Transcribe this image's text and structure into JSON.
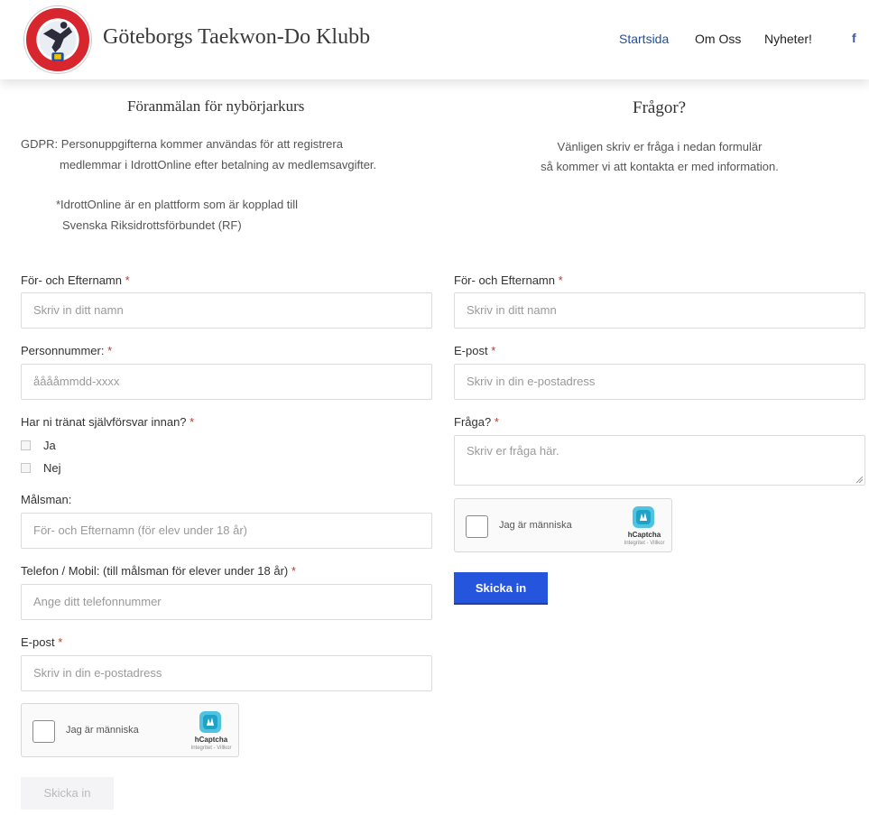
{
  "header": {
    "logo_text": "GÖTEBORGS TAEKWON-DO CLUB",
    "site_title": "Göteborgs Taekwon-Do Klubb",
    "nav": [
      {
        "label": "Startsida",
        "active": true
      },
      {
        "label": "Om Oss",
        "active": false
      },
      {
        "label": "Nyheter!",
        "active": false
      }
    ],
    "facebook_glyph": "f",
    "colors": {
      "active_nav": "#1f4f9c",
      "logo_red": "#d7262e",
      "facebook": "#3b5998"
    }
  },
  "left": {
    "title": "Föranmälan för nybörjarkurs",
    "gdpr_line1": "GDPR: Personuppgifterna kommer användas för att registrera",
    "gdpr_line2": "medlemmar i IdrottOnline efter betalning av medlemsavgifter.",
    "note_line1": "*IdrottOnline är en plattform som är kopplad till",
    "note_line2": "Svenska Riksidrottsförbundet (RF)",
    "fields": {
      "name_label": "För- och Efternamn",
      "name_placeholder": "Skriv in ditt namn",
      "pnr_label": "Personnummer:",
      "pnr_placeholder": "ååååmmdd-xxxx",
      "selfdef_label": "Har ni tränat självförsvar innan?",
      "option_yes": "Ja",
      "option_no": "Nej",
      "guardian_label": "Målsman:",
      "guardian_placeholder": "För- och Efternamn (för elev under 18 år)",
      "phone_label": "Telefon / Mobil: (till målsman för elever under 18 år)",
      "phone_placeholder": "Ange ditt telefonnummer",
      "email_label": "E-post",
      "email_placeholder": "Skriv in din e-postadress"
    },
    "required_mark": "*",
    "captcha": {
      "text": "Jag är människa",
      "brand": "hCaptcha",
      "links": "Integritet - Villkor"
    },
    "submit_label": "Skicka in"
  },
  "right": {
    "title": "Frågor?",
    "info_line1": "Vänligen skriv er fråga i nedan formulär",
    "info_line2": "så kommer vi att kontakta er med information.",
    "fields": {
      "name_label": "För- och Efternamn",
      "name_placeholder": "Skriv in ditt namn",
      "email_label": "E-post",
      "email_placeholder": "Skriv in din e-postadress",
      "question_label": "Fråga?",
      "question_placeholder": "Skriv er fråga här."
    },
    "required_mark": "*",
    "captcha": {
      "text": "Jag är människa",
      "brand": "hCaptcha",
      "links": "Integritet - Villkor"
    },
    "submit_label": "Skicka in",
    "colors": {
      "submit_bg": "#2554dd"
    }
  },
  "icons": {
    "logo": "club-logo-icon",
    "facebook": "facebook-icon",
    "hcaptcha": "hcaptcha-logo-icon"
  }
}
